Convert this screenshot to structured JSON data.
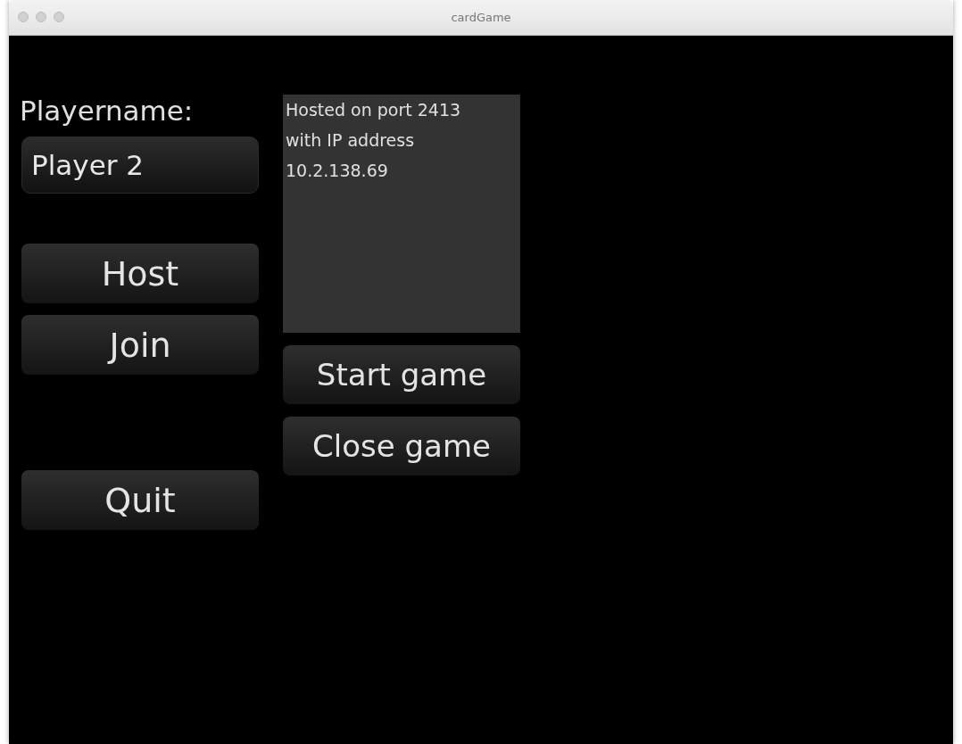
{
  "window": {
    "title": "cardGame"
  },
  "playername": {
    "label": "Playername:",
    "value": "Player 2"
  },
  "left_buttons": [
    "Host",
    "Join",
    "Quit"
  ],
  "log": {
    "lines": [
      "Hosted on port 2413",
      "with IP address",
      "10.2.138.69"
    ]
  },
  "right_buttons": [
    "Start game",
    "Close game"
  ]
}
